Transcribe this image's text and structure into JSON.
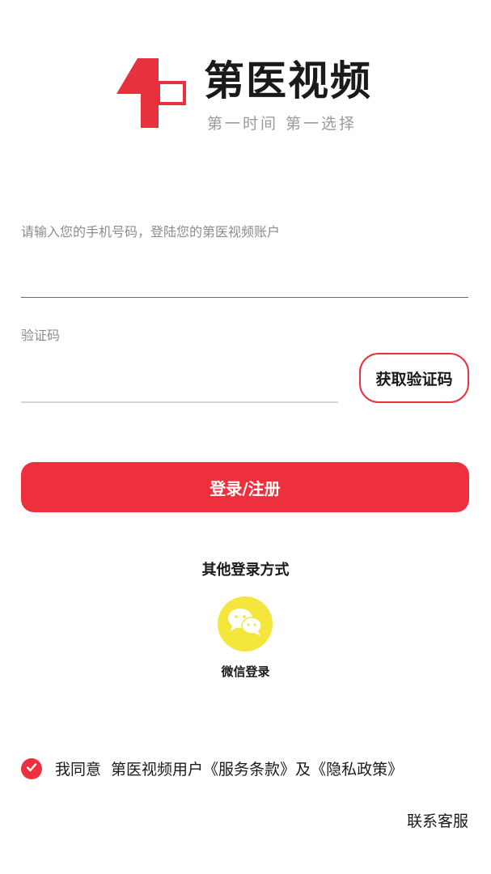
{
  "brand": {
    "name": "第医视频",
    "slogan": "第一时间   第一选择"
  },
  "login_form": {
    "phone_hint": "请输入您的手机号码，登陆您的第医视频账户",
    "phone_value": "",
    "code_label": "验证码",
    "code_value": "",
    "get_code_button": "获取验证码",
    "submit_button": "登录/注册"
  },
  "other_login": {
    "title": "其他登录方式",
    "wechat_label": "微信登录"
  },
  "agreement": {
    "checked": true,
    "prefix": "我同意",
    "app_user": "第医视频用户",
    "terms_link": "《服务条款》",
    "conjunction": "及",
    "privacy_link": "《隐私政策》"
  },
  "support_link": "联系客服",
  "colors": {
    "accent": "#ee2f3d",
    "wechat_bg": "#f4e63a",
    "hint_text": "#8c8c8c",
    "slogan_text": "#9a9a9a"
  },
  "icons": {
    "logo": "brand-logo-icon",
    "wechat": "wechat-icon",
    "check": "check-icon"
  }
}
